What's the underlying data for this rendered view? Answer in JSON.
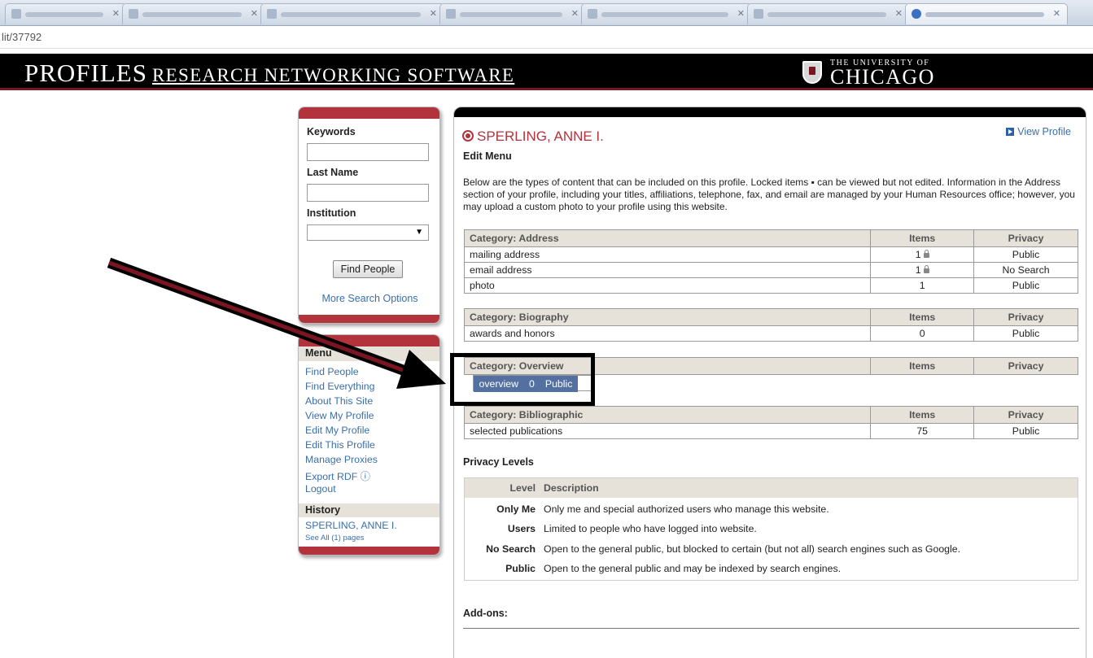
{
  "browser": {
    "url_fragment": "lit/37792"
  },
  "header": {
    "brand_main": "PROFILES",
    "brand_sub": "RESEARCH NETWORKING SOFTWARE",
    "university_small": "THE UNIVERSITY OF",
    "university_big": "CHICAGO"
  },
  "search": {
    "keywords_label": "Keywords",
    "lastname_label": "Last Name",
    "institution_label": "Institution",
    "find_button": "Find People",
    "more_options": "More Search Options"
  },
  "menu": {
    "title": "Menu",
    "items": [
      "Find People",
      "Find Everything",
      "About This Site",
      "View My Profile",
      "Edit My Profile",
      "Edit This Profile",
      "Manage Proxies",
      "Export RDF ⓘ",
      "Logout"
    ],
    "history_title": "History",
    "history_item": "SPERLING, ANNE I.",
    "see_all": "See All (1) pages"
  },
  "profile": {
    "name": "SPERLING, ANNE I.",
    "view_profile": "View Profile",
    "edit_menu": "Edit Menu",
    "intro": "Below are the types of content that can be included on this profile. Locked items ▪ can be viewed but not edited. Information in the Address section of your profile, including your titles, affiliations, telephone, fax, and email are managed by your Human Resources office; however, you may upload a custom photo to your profile using this website."
  },
  "tables": {
    "items_header": "Items",
    "privacy_header": "Privacy",
    "address": {
      "title": "Category: Address",
      "rows": [
        {
          "name": "mailing address",
          "items": "1",
          "privacy": "Public"
        },
        {
          "name": "email address",
          "items": "1",
          "privacy": "No Search"
        },
        {
          "name": "photo",
          "items": "1",
          "privacy": "Public"
        }
      ]
    },
    "biography": {
      "title": "Category: Biography",
      "rows": [
        {
          "name": "awards and honors",
          "items": "0",
          "privacy": "Public"
        }
      ]
    },
    "overview": {
      "title": "Category: Overview",
      "rows": [
        {
          "name": "overview",
          "items": "0",
          "privacy": "Public"
        }
      ]
    },
    "bibliographic": {
      "title": "Category: Bibliographic",
      "rows": [
        {
          "name": "selected publications",
          "items": "75",
          "privacy": "Public"
        }
      ]
    }
  },
  "privacy": {
    "title": "Privacy Levels",
    "level_header": "Level",
    "desc_header": "Description",
    "levels": [
      {
        "level": "Only Me",
        "desc": "Only me and special authorized users who manage this website."
      },
      {
        "level": "Users",
        "desc": "Limited to people who have logged into website."
      },
      {
        "level": "No Search",
        "desc": "Open to the general public, but blocked to certain (but not all) search engines such as Google."
      },
      {
        "level": "Public",
        "desc": "Open to the general public and may be indexed by search engines."
      }
    ]
  },
  "addons": {
    "title": "Add-ons:"
  },
  "colors": {
    "brand_red": "#b3333c",
    "selected_row": "#5470a0",
    "link": "#3a6fa8"
  }
}
